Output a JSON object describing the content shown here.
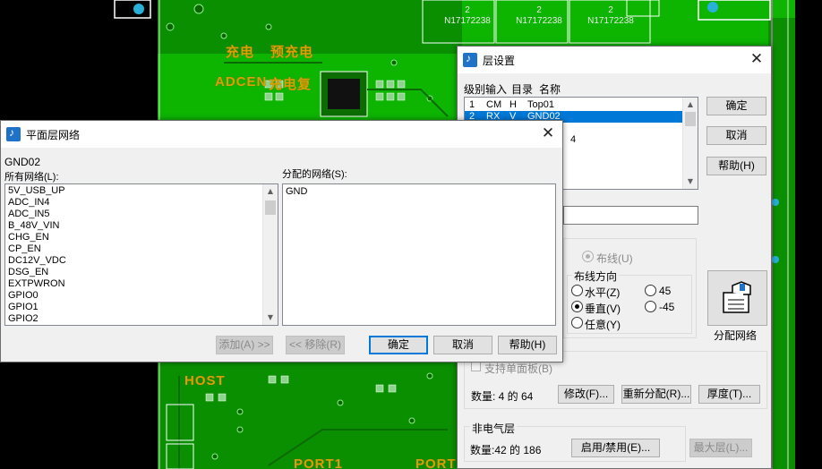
{
  "pcb": {
    "labels": [
      "充电",
      "预充电",
      "ADCEN",
      "充电复",
      "HOST",
      "PORT1",
      "PORT"
    ],
    "chip_refs": [
      {
        "num": "2",
        "part": "N17172238"
      },
      {
        "num": "2",
        "part": "N17172238"
      },
      {
        "num": "2",
        "part": "N17172238"
      }
    ]
  },
  "layer_dialog": {
    "title": "层设置",
    "close_glyph": "✕",
    "columns": {
      "level": "级别输入",
      "dir": "目录",
      "name": "名称"
    },
    "rows": [
      {
        "num": "1",
        "type": "CM",
        "dir": "H",
        "name": "Top01",
        "selected": false
      },
      {
        "num": "2",
        "type": "RX",
        "dir": "V",
        "name": "GND02",
        "selected": true
      }
    ],
    "partial_row_text": "4",
    "buttons": {
      "ok": "确定",
      "cancel": "取消",
      "help": "帮助(H)"
    },
    "routing_radio": "布线(U)",
    "routing_direction": {
      "title": "布线方向",
      "options": [
        {
          "label": "水平(Z)",
          "checked": false
        },
        {
          "label": "45",
          "checked": false
        },
        {
          "label": "垂直(V)",
          "checked": true
        },
        {
          "label": "-45",
          "checked": false
        },
        {
          "label": "任意(Y)",
          "checked": false
        }
      ]
    },
    "assign_nets_label": "分配网络",
    "single_sided_checkbox": "支持单面板(B)",
    "electrical_count": "数量: 4 的 64",
    "modify_button": "修改(F)...",
    "reassign_button": "重新分配(R)...",
    "thickness_button": "厚度(T)...",
    "non_electrical_title": "非电气层",
    "non_electrical_count": "数量:42 的 186",
    "enable_disable_button": "启用/禁用(E)...",
    "max_layers_button": "最大层(L)..."
  },
  "net_dialog": {
    "title": "平面层网络",
    "close_glyph": "✕",
    "layer_name": "GND02",
    "all_nets_label": "所有网络(L):",
    "all_nets": [
      "5V_USB_UP",
      "ADC_IN4",
      "ADC_IN5",
      "B_48V_VIN",
      "CHG_EN",
      "CP_EN",
      "DC12V_VDC",
      "DSG_EN",
      "EXTPWRON",
      "GPIO0",
      "GPIO1",
      "GPIO2"
    ],
    "assigned_nets_label": "分配的网络(S):",
    "assigned_nets": [
      "GND"
    ],
    "add_button": "添加(A) >>",
    "remove_button": "<< 移除(R)",
    "ok_button": "确定",
    "cancel_button": "取消",
    "help_button": "帮助(H)"
  },
  "colors": {
    "board_green": "#0db400",
    "dark_green": "#0a7a00",
    "trace_yellow": "#d8a000",
    "selection_blue": "#0078d7"
  }
}
